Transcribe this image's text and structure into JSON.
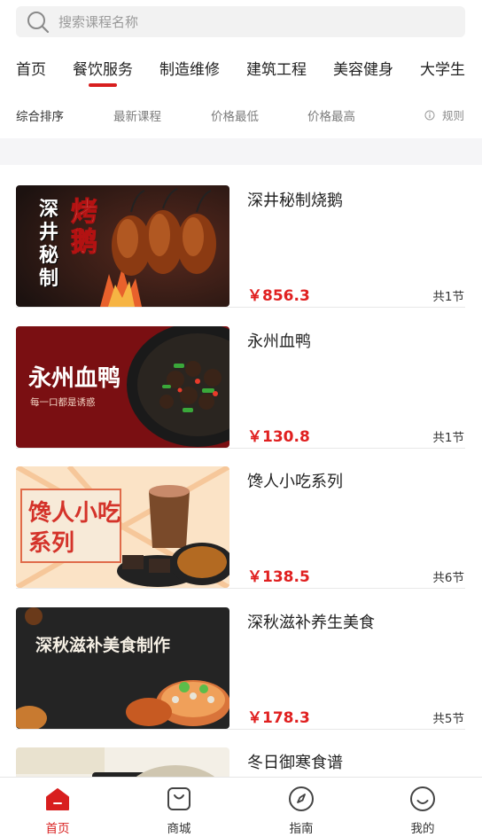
{
  "search": {
    "placeholder": "搜索课程名称"
  },
  "categories": [
    {
      "label": "首页"
    },
    {
      "label": "餐饮服务"
    },
    {
      "label": "制造维修"
    },
    {
      "label": "建筑工程"
    },
    {
      "label": "美容健身"
    },
    {
      "label": "大学生"
    }
  ],
  "active_category": "餐饮服务",
  "sort": {
    "items": [
      {
        "label": "综合排序"
      },
      {
        "label": "最新课程"
      },
      {
        "label": "价格最低"
      },
      {
        "label": "价格最高"
      }
    ],
    "rule_label": "规则"
  },
  "courses": [
    {
      "title": "深井秘制烧鹅",
      "price": "￥856.3",
      "lessons": "共1节",
      "thumb_text": "深井秘制",
      "thumb_text2": "烤鹅"
    },
    {
      "title": "永州血鸭",
      "price": "￥130.8",
      "lessons": "共1节",
      "thumb_text": "永州血鸭",
      "thumb_text2": "每一口都是诱惑"
    },
    {
      "title": "馋人小吃系列",
      "price": "￥138.5",
      "lessons": "共6节",
      "thumb_text": "馋人小吃",
      "thumb_text2": "系列"
    },
    {
      "title": "深秋滋补养生美食",
      "price": "￥178.3",
      "lessons": "共5节",
      "thumb_text": "深秋滋补美食制作",
      "thumb_text2": ""
    },
    {
      "title": "冬日御寒食谱",
      "price": "",
      "lessons": "",
      "thumb_text": "",
      "thumb_text2": ""
    }
  ],
  "tabbar": [
    {
      "label": "首页",
      "icon": "home-icon"
    },
    {
      "label": "商城",
      "icon": "shop-bag-icon"
    },
    {
      "label": "指南",
      "icon": "compass-icon"
    },
    {
      "label": "我的",
      "icon": "smile-icon"
    }
  ],
  "colors": {
    "accent": "#d81e1e",
    "price": "#e02020"
  }
}
